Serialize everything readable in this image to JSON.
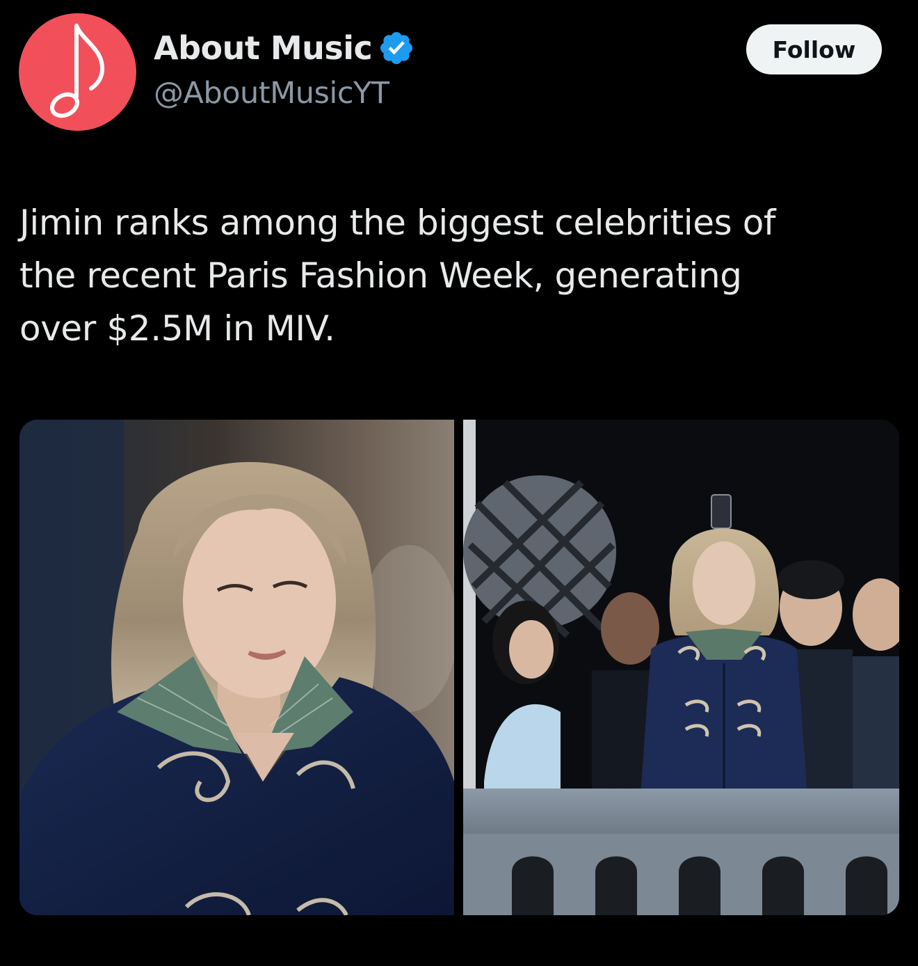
{
  "account": {
    "display_name": "About Music",
    "handle": "@AboutMusicYT",
    "avatar_icon": "music-note-icon",
    "avatar_color": "#f1505a",
    "verified": true,
    "verified_color": "#1d9bf0"
  },
  "follow_button": {
    "label": "Follow"
  },
  "tweet": {
    "lines": [
      "Jimin ranks among the biggest celebrities of",
      "the recent Paris Fashion Week, generating",
      "over $2.5M in MIV."
    ]
  },
  "media": {
    "count": 2,
    "items": [
      {
        "icon": "photo-closeup"
      },
      {
        "icon": "photo-balcony"
      }
    ]
  },
  "colors": {
    "background": "#000000",
    "text": "#e7e9ea",
    "secondary_text": "#8b98a5",
    "button_bg": "#eff3f4"
  }
}
